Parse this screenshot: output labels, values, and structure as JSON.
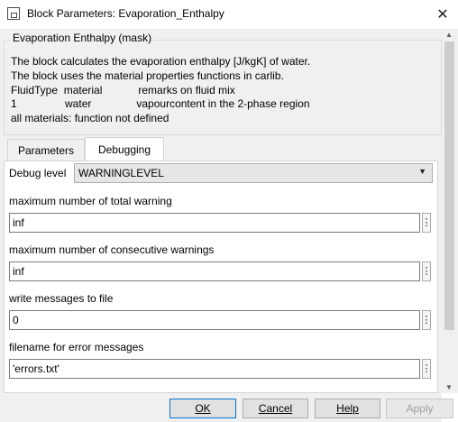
{
  "window": {
    "title": "Block Parameters: Evaporation_Enthalpy",
    "close_glyph": "✕"
  },
  "mask": {
    "group_label": "Evaporation Enthalpy (mask)",
    "description_lines": [
      "The block calculates the evaporation enthalpy [J/kgK] of water.",
      "The block uses the material properties functions in carlib.",
      "FluidType  material            remarks on fluid mix",
      "1                water               vapourcontent in the 2-phase region",
      "all materials: function not defined"
    ]
  },
  "tabs": [
    {
      "label": "Parameters",
      "active": false
    },
    {
      "label": "Debugging",
      "active": true
    }
  ],
  "debug_level": {
    "label": "Debug level",
    "value": "WARNINGLEVEL"
  },
  "fields": [
    {
      "label": "maximum number of total warning",
      "value": "inf"
    },
    {
      "label": "maximum number of consecutive warnings",
      "value": "inf"
    },
    {
      "label": "write messages to file",
      "value": "0"
    },
    {
      "label": "filename for error messages",
      "value": "'errors.txt'"
    }
  ],
  "buttons": {
    "ok": "OK",
    "cancel": "Cancel",
    "help": "Help",
    "apply": "Apply"
  },
  "icons": {
    "app": "simulink-block-icon",
    "close": "close-icon",
    "dropdown": "chevron-down-icon",
    "kebab": "vertical-ellipsis-icon"
  }
}
